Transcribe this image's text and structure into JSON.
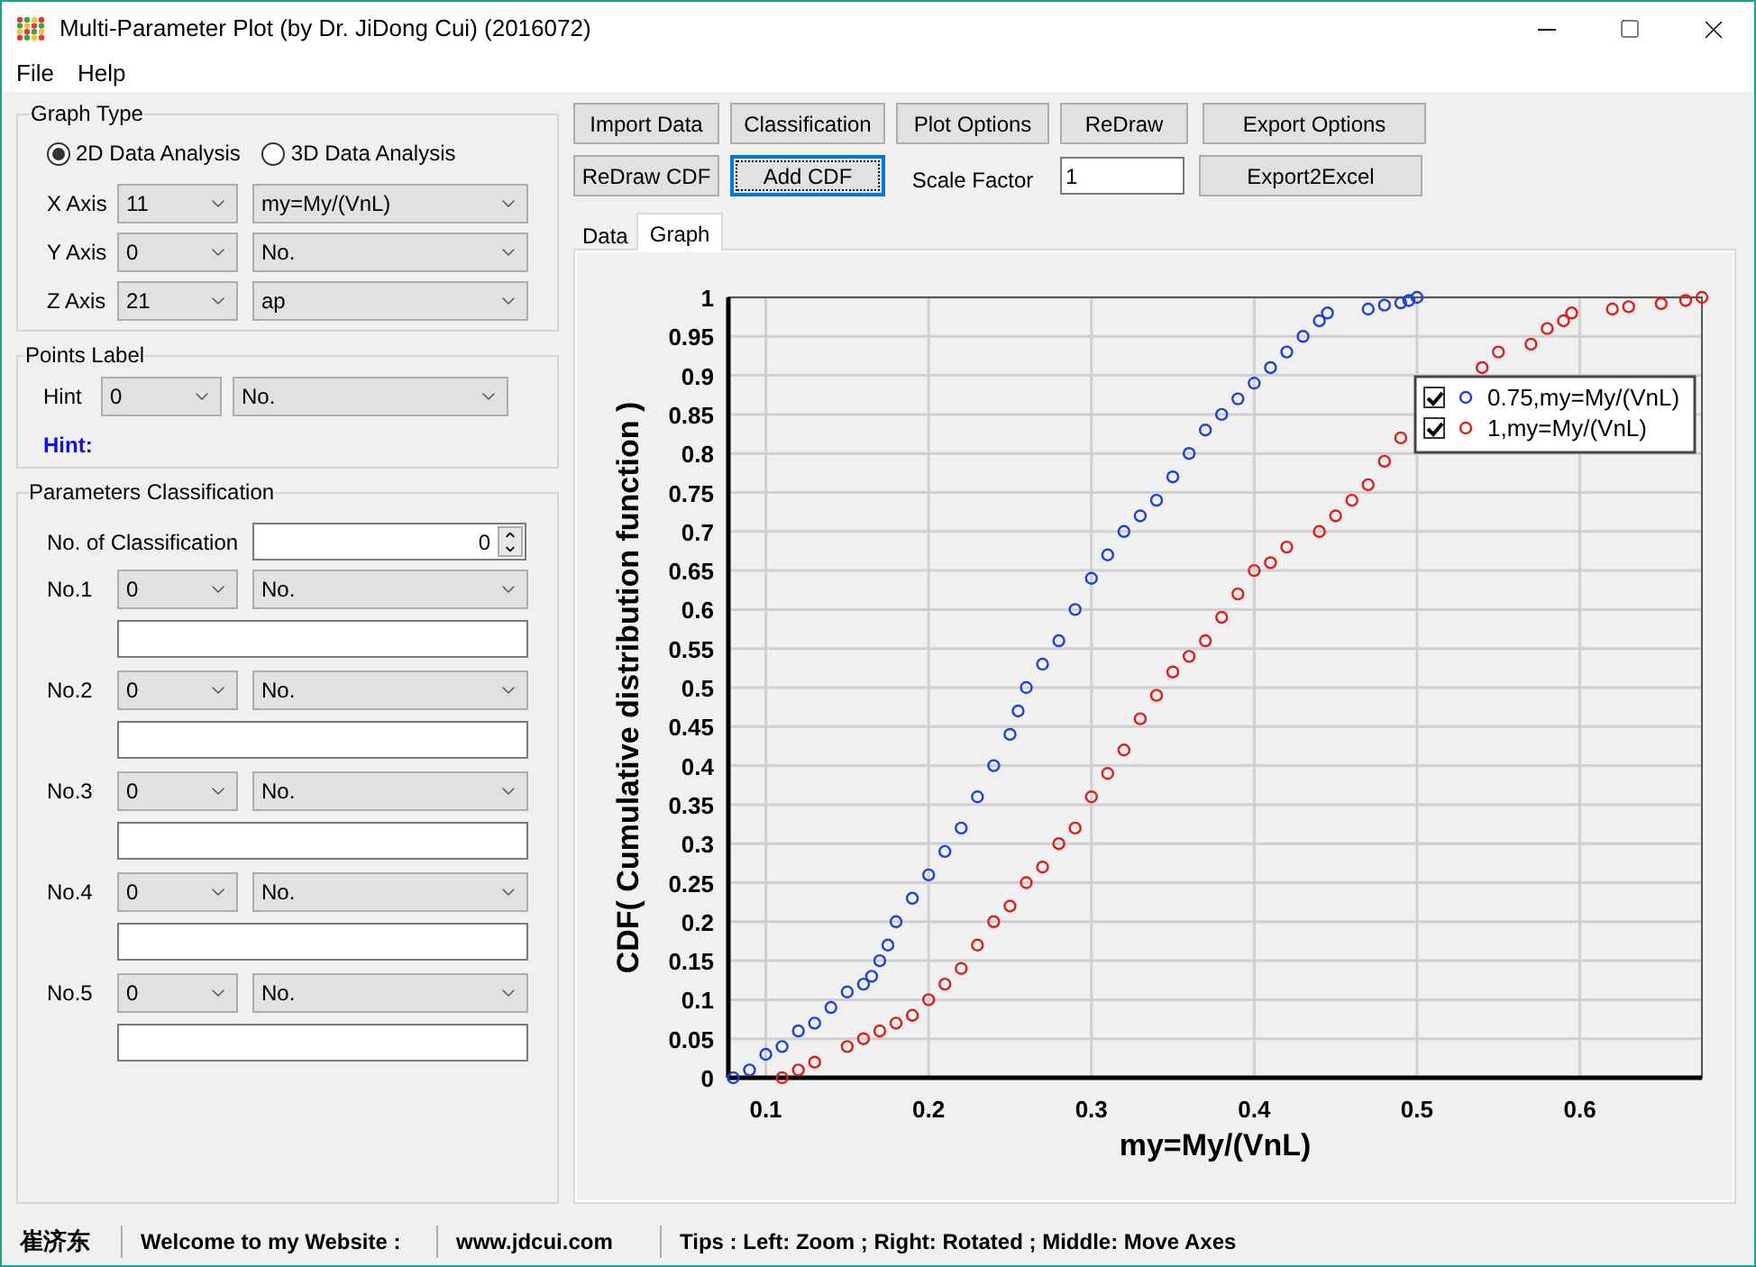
{
  "window": {
    "title": "Multi-Parameter Plot (by Dr. JiDong Cui) (2016072)"
  },
  "menu": [
    "File",
    "Help"
  ],
  "graph_type": {
    "title": "Graph Type",
    "options": [
      {
        "label": "2D Data Analysis",
        "selected": true
      },
      {
        "label": "3D Data Analysis",
        "selected": false
      }
    ],
    "axes": [
      {
        "label": "X Axis",
        "index": "11",
        "field": "my=My/(VnL)"
      },
      {
        "label": "Y Axis",
        "index": "0",
        "field": "No."
      },
      {
        "label": "Z Axis",
        "index": "21",
        "field": "ap"
      }
    ]
  },
  "points_label": {
    "title": "Points Label",
    "label": "Hint",
    "index": "0",
    "field": "No.",
    "hint": "Hint:"
  },
  "classification": {
    "title": "Parameters Classification",
    "count_label": "No. of Classification",
    "count": "0",
    "groups": [
      {
        "label": "No.1",
        "index": "0",
        "field": "No."
      },
      {
        "label": "No.2",
        "index": "0",
        "field": "No."
      },
      {
        "label": "No.3",
        "index": "0",
        "field": "No."
      },
      {
        "label": "No.4",
        "index": "0",
        "field": "No."
      },
      {
        "label": "No.5",
        "index": "0",
        "field": "No."
      }
    ]
  },
  "toolbar": [
    [
      {
        "kind": "button",
        "label": "Import Data",
        "focused": false
      },
      {
        "kind": "button",
        "label": "Classification",
        "focused": false
      },
      {
        "kind": "button",
        "label": "Plot Options",
        "focused": false
      },
      {
        "kind": "button",
        "label": "ReDraw",
        "focused": false
      },
      {
        "kind": "button",
        "label": "Export Options",
        "focused": false
      }
    ],
    [
      {
        "kind": "button",
        "label": "ReDraw CDF",
        "focused": false
      },
      {
        "kind": "button",
        "label": "Add CDF",
        "focused": true
      },
      {
        "kind": "label",
        "label": "Scale Factor"
      },
      {
        "kind": "input",
        "value": "1"
      },
      {
        "kind": "button",
        "label": "Export2Excel",
        "focused": false
      }
    ]
  ],
  "tabs": [
    {
      "label": "Data",
      "selected": false
    },
    {
      "label": "Graph",
      "selected": true
    }
  ],
  "chart_data": {
    "type": "scatter",
    "xlabel": "my=My/(VnL)",
    "ylabel": "CDF( Cumulative distribution function )",
    "xlim": [
      0.077,
      0.675
    ],
    "ylim": [
      0,
      1
    ],
    "xticks": [
      0.1,
      0.2,
      0.3,
      0.4,
      0.5,
      0.6
    ],
    "yticks": [
      {
        "value": 0,
        "label": "0"
      },
      0.05,
      0.1,
      0.15,
      0.2,
      0.25,
      0.3,
      0.35,
      0.4,
      0.45,
      0.5,
      0.55,
      0.6,
      0.65,
      0.7,
      0.75,
      0.8,
      0.85,
      0.9,
      0.95,
      {
        "value": 1,
        "label": "1"
      }
    ],
    "grid": true,
    "legend": true,
    "series": [
      {
        "name": "0.75,my=My/(VnL)",
        "color": "#1f3fdc",
        "x": [
          0.08,
          0.09,
          0.1,
          0.11,
          0.12,
          0.13,
          0.14,
          0.15,
          0.16,
          0.165,
          0.17,
          0.175,
          0.18,
          0.19,
          0.2,
          0.21,
          0.22,
          0.23,
          0.24,
          0.25,
          0.255,
          0.26,
          0.27,
          0.28,
          0.29,
          0.3,
          0.31,
          0.32,
          0.33,
          0.34,
          0.35,
          0.36,
          0.37,
          0.38,
          0.39,
          0.4,
          0.41,
          0.42,
          0.43,
          0.44,
          0.445,
          0.47,
          0.48,
          0.49,
          0.495,
          0.5
        ],
        "values": [
          0,
          0.01,
          0.03,
          0.04,
          0.06,
          0.07,
          0.09,
          0.11,
          0.12,
          0.13,
          0.15,
          0.17,
          0.2,
          0.23,
          0.26,
          0.29,
          0.32,
          0.36,
          0.4,
          0.44,
          0.47,
          0.5,
          0.53,
          0.56,
          0.6,
          0.64,
          0.67,
          0.7,
          0.72,
          0.74,
          0.77,
          0.8,
          0.83,
          0.85,
          0.87,
          0.89,
          0.91,
          0.93,
          0.95,
          0.97,
          0.98,
          0.985,
          0.99,
          0.993,
          0.996,
          1
        ]
      },
      {
        "name": "1,my=My/(VnL)",
        "color": "#e01c1c",
        "x": [
          0.11,
          0.12,
          0.13,
          0.15,
          0.16,
          0.17,
          0.18,
          0.19,
          0.2,
          0.21,
          0.22,
          0.23,
          0.24,
          0.25,
          0.26,
          0.27,
          0.28,
          0.29,
          0.3,
          0.31,
          0.32,
          0.33,
          0.34,
          0.35,
          0.36,
          0.37,
          0.38,
          0.39,
          0.4,
          0.41,
          0.42,
          0.44,
          0.45,
          0.46,
          0.47,
          0.48,
          0.49,
          0.5,
          0.54,
          0.55,
          0.57,
          0.58,
          0.59,
          0.595,
          0.62,
          0.63,
          0.65,
          0.665,
          0.675
        ],
        "values": [
          0,
          0.01,
          0.02,
          0.04,
          0.05,
          0.06,
          0.07,
          0.08,
          0.1,
          0.12,
          0.14,
          0.17,
          0.2,
          0.22,
          0.25,
          0.27,
          0.3,
          0.32,
          0.36,
          0.39,
          0.42,
          0.46,
          0.49,
          0.52,
          0.54,
          0.56,
          0.59,
          0.62,
          0.65,
          0.66,
          0.68,
          0.7,
          0.72,
          0.74,
          0.76,
          0.79,
          0.82,
          null,
          0.91,
          0.93,
          0.94,
          0.96,
          0.97,
          0.98,
          0.985,
          0.988,
          0.992,
          0.996,
          1
        ]
      }
    ]
  },
  "legend_checkboxes": [
    {
      "checked": true
    },
    {
      "checked": true
    }
  ],
  "status_bar": [
    "崔济东",
    "Welcome to my Website :",
    "www.jdcui.com",
    "Tips : Left: Zoom ; Right: Rotated ; Middle: Move Axes"
  ]
}
